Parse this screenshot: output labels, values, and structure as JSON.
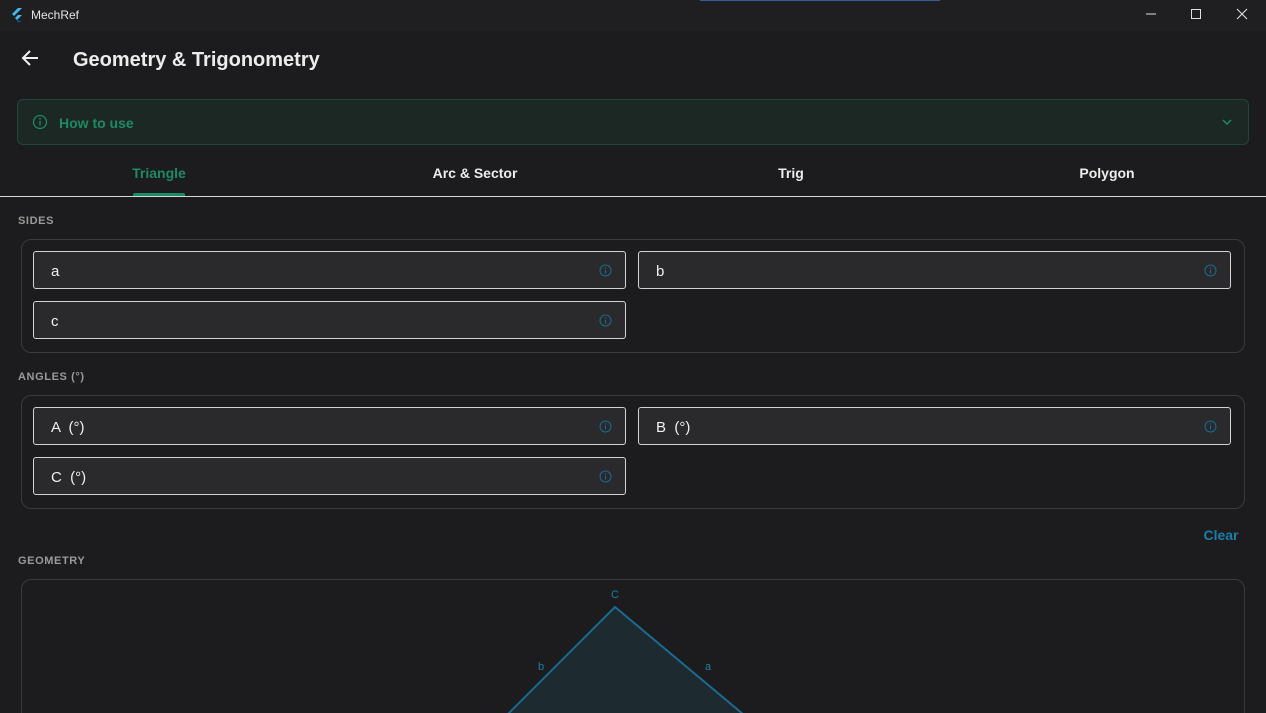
{
  "window": {
    "title": "MechRef",
    "icons": [
      "flutter-logo-icon",
      "minimize-icon",
      "maximize-icon",
      "close-icon"
    ]
  },
  "appbar": {
    "title": "Geometry & Trigonometry",
    "back_icon": "arrow-left-icon"
  },
  "howto": {
    "label": "How to use",
    "icon": "info-icon",
    "expand_icon": "chevron-down-icon"
  },
  "tabs": [
    {
      "label": "Triangle",
      "active": true
    },
    {
      "label": "Arc & Sector",
      "active": false
    },
    {
      "label": "Trig",
      "active": false
    },
    {
      "label": "Polygon",
      "active": false
    }
  ],
  "sides": {
    "heading": "SIDES",
    "fields": [
      {
        "label": "a",
        "value": ""
      },
      {
        "label": "b",
        "value": ""
      },
      {
        "label": "c",
        "value": ""
      }
    ]
  },
  "angles": {
    "heading": "ANGLES (°)",
    "fields": [
      {
        "label": "A  (°)",
        "value": ""
      },
      {
        "label": "B  (°)",
        "value": ""
      },
      {
        "label": "C  (°)",
        "value": ""
      }
    ]
  },
  "actions": {
    "clear_label": "Clear"
  },
  "geometry": {
    "heading": "GEOMETRY",
    "vertex_label_c": "C",
    "side_label_a": "a",
    "side_label_b": "b"
  },
  "colors": {
    "accent_green": "#1e8a63",
    "accent_blue": "#1a7fa8",
    "background": "#1c1c1e"
  }
}
